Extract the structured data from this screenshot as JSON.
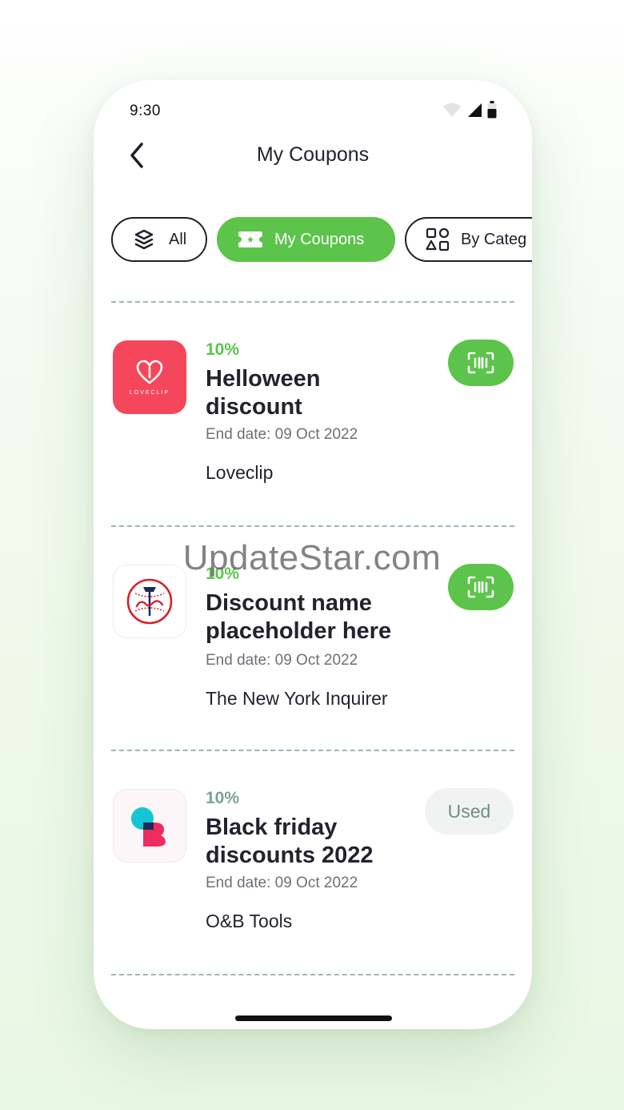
{
  "status_bar": {
    "time": "9:30"
  },
  "header": {
    "title": "My Coupons"
  },
  "tabs": [
    {
      "label": "All",
      "icon": "layers-icon",
      "active": false
    },
    {
      "label": "My Coupons",
      "icon": "ticket-icon",
      "active": true
    },
    {
      "label": "By Categ",
      "icon": "categories-icon",
      "active": false
    }
  ],
  "coupons": [
    {
      "percent": "10%",
      "name": "Helloween discount",
      "end_date": "End date: 09 Oct 2022",
      "merchant": "Loveclip",
      "logo_text": "LOVECLIP",
      "action": "scan"
    },
    {
      "percent": "10%",
      "name": "Discount name placeholder here",
      "end_date": "End date: 09 Oct 2022",
      "merchant": "The New York Inquirer",
      "action": "scan"
    },
    {
      "percent": "10%",
      "name": "Black friday discounts 2022",
      "end_date": "End date: 09 Oct 2022",
      "merchant": "O&B Tools",
      "action": "used",
      "used_label": "Used"
    }
  ],
  "colors": {
    "accent": "#5cc44a",
    "muted_percent": "#78a29a",
    "loveclip_brand": "#f5475c",
    "text_dark": "#23232f"
  },
  "watermark": "UpdateStar.com"
}
